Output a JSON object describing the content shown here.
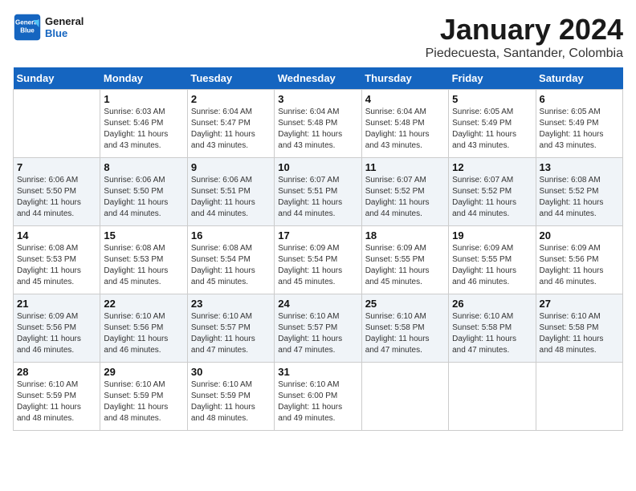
{
  "header": {
    "logo_line1": "General",
    "logo_line2": "Blue",
    "month_year": "January 2024",
    "location": "Piedecuesta, Santander, Colombia"
  },
  "weekdays": [
    "Sunday",
    "Monday",
    "Tuesday",
    "Wednesday",
    "Thursday",
    "Friday",
    "Saturday"
  ],
  "weeks": [
    [
      {
        "day": "",
        "info": ""
      },
      {
        "day": "1",
        "info": "Sunrise: 6:03 AM\nSunset: 5:46 PM\nDaylight: 11 hours\nand 43 minutes."
      },
      {
        "day": "2",
        "info": "Sunrise: 6:04 AM\nSunset: 5:47 PM\nDaylight: 11 hours\nand 43 minutes."
      },
      {
        "day": "3",
        "info": "Sunrise: 6:04 AM\nSunset: 5:48 PM\nDaylight: 11 hours\nand 43 minutes."
      },
      {
        "day": "4",
        "info": "Sunrise: 6:04 AM\nSunset: 5:48 PM\nDaylight: 11 hours\nand 43 minutes."
      },
      {
        "day": "5",
        "info": "Sunrise: 6:05 AM\nSunset: 5:49 PM\nDaylight: 11 hours\nand 43 minutes."
      },
      {
        "day": "6",
        "info": "Sunrise: 6:05 AM\nSunset: 5:49 PM\nDaylight: 11 hours\nand 43 minutes."
      }
    ],
    [
      {
        "day": "7",
        "info": "Sunrise: 6:06 AM\nSunset: 5:50 PM\nDaylight: 11 hours\nand 44 minutes."
      },
      {
        "day": "8",
        "info": "Sunrise: 6:06 AM\nSunset: 5:50 PM\nDaylight: 11 hours\nand 44 minutes."
      },
      {
        "day": "9",
        "info": "Sunrise: 6:06 AM\nSunset: 5:51 PM\nDaylight: 11 hours\nand 44 minutes."
      },
      {
        "day": "10",
        "info": "Sunrise: 6:07 AM\nSunset: 5:51 PM\nDaylight: 11 hours\nand 44 minutes."
      },
      {
        "day": "11",
        "info": "Sunrise: 6:07 AM\nSunset: 5:52 PM\nDaylight: 11 hours\nand 44 minutes."
      },
      {
        "day": "12",
        "info": "Sunrise: 6:07 AM\nSunset: 5:52 PM\nDaylight: 11 hours\nand 44 minutes."
      },
      {
        "day": "13",
        "info": "Sunrise: 6:08 AM\nSunset: 5:52 PM\nDaylight: 11 hours\nand 44 minutes."
      }
    ],
    [
      {
        "day": "14",
        "info": "Sunrise: 6:08 AM\nSunset: 5:53 PM\nDaylight: 11 hours\nand 45 minutes."
      },
      {
        "day": "15",
        "info": "Sunrise: 6:08 AM\nSunset: 5:53 PM\nDaylight: 11 hours\nand 45 minutes."
      },
      {
        "day": "16",
        "info": "Sunrise: 6:08 AM\nSunset: 5:54 PM\nDaylight: 11 hours\nand 45 minutes."
      },
      {
        "day": "17",
        "info": "Sunrise: 6:09 AM\nSunset: 5:54 PM\nDaylight: 11 hours\nand 45 minutes."
      },
      {
        "day": "18",
        "info": "Sunrise: 6:09 AM\nSunset: 5:55 PM\nDaylight: 11 hours\nand 45 minutes."
      },
      {
        "day": "19",
        "info": "Sunrise: 6:09 AM\nSunset: 5:55 PM\nDaylight: 11 hours\nand 46 minutes."
      },
      {
        "day": "20",
        "info": "Sunrise: 6:09 AM\nSunset: 5:56 PM\nDaylight: 11 hours\nand 46 minutes."
      }
    ],
    [
      {
        "day": "21",
        "info": "Sunrise: 6:09 AM\nSunset: 5:56 PM\nDaylight: 11 hours\nand 46 minutes."
      },
      {
        "day": "22",
        "info": "Sunrise: 6:10 AM\nSunset: 5:56 PM\nDaylight: 11 hours\nand 46 minutes."
      },
      {
        "day": "23",
        "info": "Sunrise: 6:10 AM\nSunset: 5:57 PM\nDaylight: 11 hours\nand 47 minutes."
      },
      {
        "day": "24",
        "info": "Sunrise: 6:10 AM\nSunset: 5:57 PM\nDaylight: 11 hours\nand 47 minutes."
      },
      {
        "day": "25",
        "info": "Sunrise: 6:10 AM\nSunset: 5:58 PM\nDaylight: 11 hours\nand 47 minutes."
      },
      {
        "day": "26",
        "info": "Sunrise: 6:10 AM\nSunset: 5:58 PM\nDaylight: 11 hours\nand 47 minutes."
      },
      {
        "day": "27",
        "info": "Sunrise: 6:10 AM\nSunset: 5:58 PM\nDaylight: 11 hours\nand 48 minutes."
      }
    ],
    [
      {
        "day": "28",
        "info": "Sunrise: 6:10 AM\nSunset: 5:59 PM\nDaylight: 11 hours\nand 48 minutes."
      },
      {
        "day": "29",
        "info": "Sunrise: 6:10 AM\nSunset: 5:59 PM\nDaylight: 11 hours\nand 48 minutes."
      },
      {
        "day": "30",
        "info": "Sunrise: 6:10 AM\nSunset: 5:59 PM\nDaylight: 11 hours\nand 48 minutes."
      },
      {
        "day": "31",
        "info": "Sunrise: 6:10 AM\nSunset: 6:00 PM\nDaylight: 11 hours\nand 49 minutes."
      },
      {
        "day": "",
        "info": ""
      },
      {
        "day": "",
        "info": ""
      },
      {
        "day": "",
        "info": ""
      }
    ]
  ]
}
